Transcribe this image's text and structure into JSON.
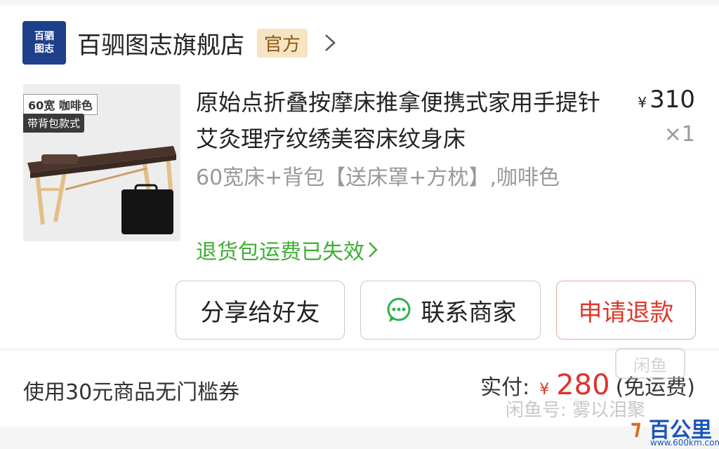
{
  "store": {
    "logo_line1": "百驷",
    "logo_line2": "图志",
    "name": "百驷图志旗舰店",
    "badge": "官方",
    "chevron_icon": "chevron-right-icon"
  },
  "product": {
    "thumb_tag_width_color": "60宽 咖啡色",
    "thumb_tag_style": "带背包款式",
    "title": "原始点折叠按摩床推拿便携式家用手提针艾灸理疗纹绣美容床纹身床",
    "price_symbol": "¥",
    "price": "310",
    "quantity": "×1",
    "spec": "60宽床+背包【送床罩+方枕】,咖啡色",
    "return_note": "退货包运费已失效"
  },
  "actions": {
    "share": "分享给好友",
    "contact": "联系商家",
    "refund": "申请退款"
  },
  "footer": {
    "coupon": "使用30元商品无门槛券",
    "paid_label": "实付:",
    "paid_symbol": "¥",
    "paid_amount": "280",
    "paid_note": "(免运费)"
  },
  "watermarks": {
    "xianyu_logo": "闲鱼",
    "xianyu_account": "闲鱼号: 雾以泪聚",
    "site_brand": "百公里",
    "site_url": "www.600km.com"
  },
  "colors": {
    "accent_red": "#e0322d",
    "green": "#3fae33",
    "store_logo_bg": "#1e3f8a",
    "badge_bg": "#f6e4c4"
  }
}
